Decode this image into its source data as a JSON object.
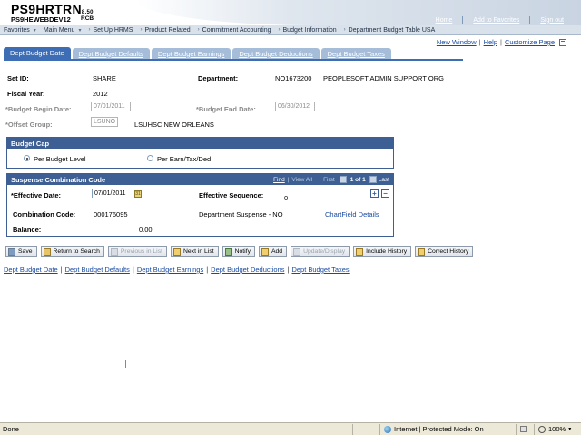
{
  "banner": {
    "db_name": "PS9HRTRN",
    "db_version": "8.50",
    "server": "PS9HEWEBDEV12",
    "user": "RCB",
    "links": [
      "Home",
      "Add to Favorites",
      "Sign out"
    ]
  },
  "menu": {
    "items": [
      "Favorites",
      "Main Menu",
      "Set Up HRMS",
      "Product Related",
      "Commitment Accounting",
      "Budget Information",
      "Department Budget Table USA"
    ]
  },
  "pagebar": {
    "new_window": "New Window",
    "help": "Help",
    "customize": "Customize Page"
  },
  "tabs": [
    {
      "label": "Dept Budget Date",
      "active": true
    },
    {
      "label": "Dept Budget Defaults",
      "active": false
    },
    {
      "label": "Dept Budget Earnings",
      "active": false
    },
    {
      "label": "Dept Budget Deductions",
      "active": false
    },
    {
      "label": "Dept Budget Taxes",
      "active": false
    }
  ],
  "form": {
    "setid_label": "Set ID:",
    "setid_value": "SHARE",
    "department_label": "Department:",
    "department_code": "NO1673200",
    "department_name": "PEOPLESOFT ADMIN SUPPORT ORG",
    "fiscal_year_label": "Fiscal Year:",
    "fiscal_year_value": "2012",
    "begin_date_label": "*Budget Begin Date:",
    "begin_date_value": "07/01/2011",
    "end_date_label": "*Budget End Date:",
    "end_date_value": "06/30/2012",
    "offset_group_label": "*Offset Group:",
    "offset_group_value": "LSUNO",
    "offset_group_desc": "LSUHSC NEW ORLEANS"
  },
  "budget_cap": {
    "title": "Budget Cap",
    "options": [
      "Per Budget Level",
      "Per Earn/Tax/Ded"
    ],
    "selected": "Per Budget Level"
  },
  "suspense": {
    "title": "Suspense Combination Code",
    "nav": {
      "find": "Find",
      "view_all": "View All",
      "first": "First",
      "position": "1 of 1",
      "last": "Last"
    },
    "effective_date_label": "*Effective Date:",
    "effective_date_value": "07/01/2011",
    "effective_seq_label": "Effective Sequence:",
    "effective_seq_value": "0",
    "combo_code_label": "Combination Code:",
    "combo_code_value": "000176095",
    "combo_desc": "Department Suspense - NO",
    "chartfield_link": "ChartField Details",
    "balance_label": "Balance:",
    "balance_value": "0.00"
  },
  "toolbar": {
    "save": "Save",
    "return_to_search": "Return to Search",
    "previous_in_list": "Previous in List",
    "next_in_list": "Next in List",
    "notify": "Notify",
    "add": "Add",
    "update_display": "Update/Display",
    "include_history": "Include History",
    "correct_history": "Correct History"
  },
  "bottom_links": [
    "Dept Budget Date",
    "Dept Budget Defaults",
    "Dept Budget Earnings",
    "Dept Budget Deductions",
    "Dept Budget Taxes"
  ],
  "statusbar": {
    "status": "Done",
    "zone": "Internet | Protected Mode: On",
    "zoom": "100%"
  }
}
